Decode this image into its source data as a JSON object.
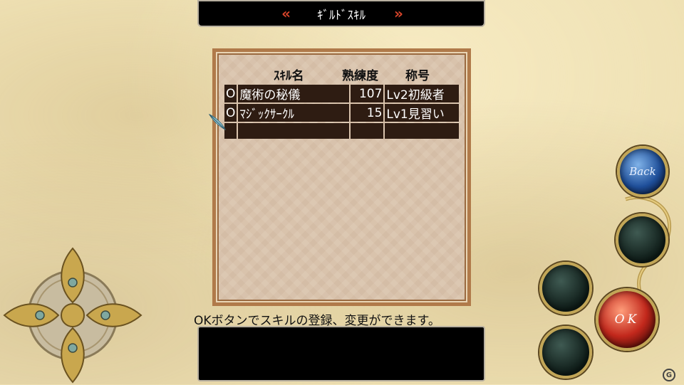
{
  "screen": {
    "title": "ｷﾞﾙﾄﾞｽｷﾙ",
    "left_arrow": "«",
    "right_arrow": "»"
  },
  "skill_table": {
    "headers": {
      "name": "ｽｷﾙ名",
      "proficiency": "熟練度",
      "title": "称号"
    },
    "rows": [
      {
        "mark": "O",
        "name": "魔術の秘儀",
        "proficiency": "107",
        "title": "Lv2初級者"
      },
      {
        "mark": "O",
        "name": "ﾏｼﾞｯｸｻｰｸﾙ",
        "proficiency": "15",
        "title": "Lv1見習い"
      },
      {
        "mark": "",
        "name": "",
        "proficiency": "",
        "title": ""
      }
    ]
  },
  "help_message": "OKボタンでスキルの登録、変更ができます。",
  "message_box_text": "",
  "controls": {
    "back_label": "Back",
    "ok_label": "OK"
  },
  "watermark": "G"
}
